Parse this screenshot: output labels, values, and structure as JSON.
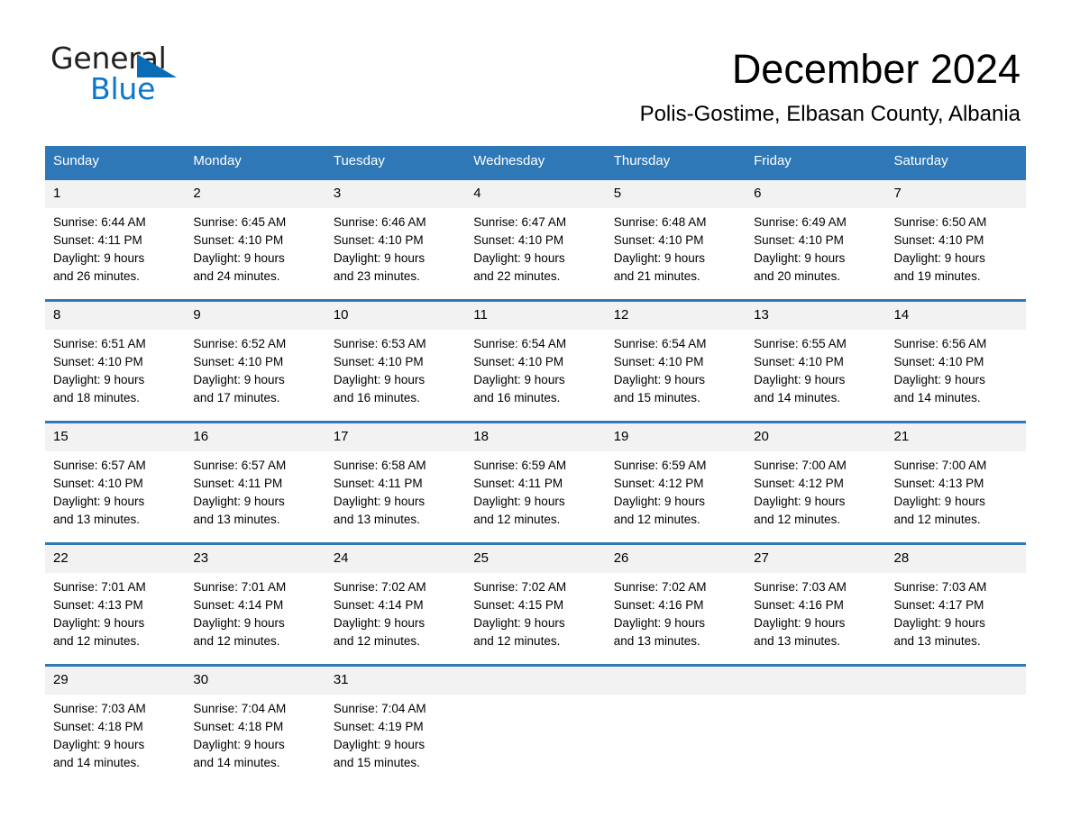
{
  "brand": {
    "name_part1": "General",
    "name_part2": "Blue",
    "triangle_color": "#0a6cb4",
    "blue_text_color": "#0b76cc"
  },
  "header": {
    "month_title": "December 2024",
    "location": "Polis-Gostime, Elbasan County, Albania"
  },
  "theme": {
    "header_blue": "#2e78b8",
    "daynum_band": "#f2f2f2",
    "text": "#000000"
  },
  "weekdays": [
    "Sunday",
    "Monday",
    "Tuesday",
    "Wednesday",
    "Thursday",
    "Friday",
    "Saturday"
  ],
  "weeks": [
    {
      "days": [
        {
          "num": "1",
          "sunrise": "Sunrise: 6:44 AM",
          "sunset": "Sunset: 4:11 PM",
          "daylight_line1": "Daylight: 9 hours",
          "daylight_line2": "and 26 minutes."
        },
        {
          "num": "2",
          "sunrise": "Sunrise: 6:45 AM",
          "sunset": "Sunset: 4:10 PM",
          "daylight_line1": "Daylight: 9 hours",
          "daylight_line2": "and 24 minutes."
        },
        {
          "num": "3",
          "sunrise": "Sunrise: 6:46 AM",
          "sunset": "Sunset: 4:10 PM",
          "daylight_line1": "Daylight: 9 hours",
          "daylight_line2": "and 23 minutes."
        },
        {
          "num": "4",
          "sunrise": "Sunrise: 6:47 AM",
          "sunset": "Sunset: 4:10 PM",
          "daylight_line1": "Daylight: 9 hours",
          "daylight_line2": "and 22 minutes."
        },
        {
          "num": "5",
          "sunrise": "Sunrise: 6:48 AM",
          "sunset": "Sunset: 4:10 PM",
          "daylight_line1": "Daylight: 9 hours",
          "daylight_line2": "and 21 minutes."
        },
        {
          "num": "6",
          "sunrise": "Sunrise: 6:49 AM",
          "sunset": "Sunset: 4:10 PM",
          "daylight_line1": "Daylight: 9 hours",
          "daylight_line2": "and 20 minutes."
        },
        {
          "num": "7",
          "sunrise": "Sunrise: 6:50 AM",
          "sunset": "Sunset: 4:10 PM",
          "daylight_line1": "Daylight: 9 hours",
          "daylight_line2": "and 19 minutes."
        }
      ]
    },
    {
      "days": [
        {
          "num": "8",
          "sunrise": "Sunrise: 6:51 AM",
          "sunset": "Sunset: 4:10 PM",
          "daylight_line1": "Daylight: 9 hours",
          "daylight_line2": "and 18 minutes."
        },
        {
          "num": "9",
          "sunrise": "Sunrise: 6:52 AM",
          "sunset": "Sunset: 4:10 PM",
          "daylight_line1": "Daylight: 9 hours",
          "daylight_line2": "and 17 minutes."
        },
        {
          "num": "10",
          "sunrise": "Sunrise: 6:53 AM",
          "sunset": "Sunset: 4:10 PM",
          "daylight_line1": "Daylight: 9 hours",
          "daylight_line2": "and 16 minutes."
        },
        {
          "num": "11",
          "sunrise": "Sunrise: 6:54 AM",
          "sunset": "Sunset: 4:10 PM",
          "daylight_line1": "Daylight: 9 hours",
          "daylight_line2": "and 16 minutes."
        },
        {
          "num": "12",
          "sunrise": "Sunrise: 6:54 AM",
          "sunset": "Sunset: 4:10 PM",
          "daylight_line1": "Daylight: 9 hours",
          "daylight_line2": "and 15 minutes."
        },
        {
          "num": "13",
          "sunrise": "Sunrise: 6:55 AM",
          "sunset": "Sunset: 4:10 PM",
          "daylight_line1": "Daylight: 9 hours",
          "daylight_line2": "and 14 minutes."
        },
        {
          "num": "14",
          "sunrise": "Sunrise: 6:56 AM",
          "sunset": "Sunset: 4:10 PM",
          "daylight_line1": "Daylight: 9 hours",
          "daylight_line2": "and 14 minutes."
        }
      ]
    },
    {
      "days": [
        {
          "num": "15",
          "sunrise": "Sunrise: 6:57 AM",
          "sunset": "Sunset: 4:10 PM",
          "daylight_line1": "Daylight: 9 hours",
          "daylight_line2": "and 13 minutes."
        },
        {
          "num": "16",
          "sunrise": "Sunrise: 6:57 AM",
          "sunset": "Sunset: 4:11 PM",
          "daylight_line1": "Daylight: 9 hours",
          "daylight_line2": "and 13 minutes."
        },
        {
          "num": "17",
          "sunrise": "Sunrise: 6:58 AM",
          "sunset": "Sunset: 4:11 PM",
          "daylight_line1": "Daylight: 9 hours",
          "daylight_line2": "and 13 minutes."
        },
        {
          "num": "18",
          "sunrise": "Sunrise: 6:59 AM",
          "sunset": "Sunset: 4:11 PM",
          "daylight_line1": "Daylight: 9 hours",
          "daylight_line2": "and 12 minutes."
        },
        {
          "num": "19",
          "sunrise": "Sunrise: 6:59 AM",
          "sunset": "Sunset: 4:12 PM",
          "daylight_line1": "Daylight: 9 hours",
          "daylight_line2": "and 12 minutes."
        },
        {
          "num": "20",
          "sunrise": "Sunrise: 7:00 AM",
          "sunset": "Sunset: 4:12 PM",
          "daylight_line1": "Daylight: 9 hours",
          "daylight_line2": "and 12 minutes."
        },
        {
          "num": "21",
          "sunrise": "Sunrise: 7:00 AM",
          "sunset": "Sunset: 4:13 PM",
          "daylight_line1": "Daylight: 9 hours",
          "daylight_line2": "and 12 minutes."
        }
      ]
    },
    {
      "days": [
        {
          "num": "22",
          "sunrise": "Sunrise: 7:01 AM",
          "sunset": "Sunset: 4:13 PM",
          "daylight_line1": "Daylight: 9 hours",
          "daylight_line2": "and 12 minutes."
        },
        {
          "num": "23",
          "sunrise": "Sunrise: 7:01 AM",
          "sunset": "Sunset: 4:14 PM",
          "daylight_line1": "Daylight: 9 hours",
          "daylight_line2": "and 12 minutes."
        },
        {
          "num": "24",
          "sunrise": "Sunrise: 7:02 AM",
          "sunset": "Sunset: 4:14 PM",
          "daylight_line1": "Daylight: 9 hours",
          "daylight_line2": "and 12 minutes."
        },
        {
          "num": "25",
          "sunrise": "Sunrise: 7:02 AM",
          "sunset": "Sunset: 4:15 PM",
          "daylight_line1": "Daylight: 9 hours",
          "daylight_line2": "and 12 minutes."
        },
        {
          "num": "26",
          "sunrise": "Sunrise: 7:02 AM",
          "sunset": "Sunset: 4:16 PM",
          "daylight_line1": "Daylight: 9 hours",
          "daylight_line2": "and 13 minutes."
        },
        {
          "num": "27",
          "sunrise": "Sunrise: 7:03 AM",
          "sunset": "Sunset: 4:16 PM",
          "daylight_line1": "Daylight: 9 hours",
          "daylight_line2": "and 13 minutes."
        },
        {
          "num": "28",
          "sunrise": "Sunrise: 7:03 AM",
          "sunset": "Sunset: 4:17 PM",
          "daylight_line1": "Daylight: 9 hours",
          "daylight_line2": "and 13 minutes."
        }
      ]
    },
    {
      "days": [
        {
          "num": "29",
          "sunrise": "Sunrise: 7:03 AM",
          "sunset": "Sunset: 4:18 PM",
          "daylight_line1": "Daylight: 9 hours",
          "daylight_line2": "and 14 minutes."
        },
        {
          "num": "30",
          "sunrise": "Sunrise: 7:04 AM",
          "sunset": "Sunset: 4:18 PM",
          "daylight_line1": "Daylight: 9 hours",
          "daylight_line2": "and 14 minutes."
        },
        {
          "num": "31",
          "sunrise": "Sunrise: 7:04 AM",
          "sunset": "Sunset: 4:19 PM",
          "daylight_line1": "Daylight: 9 hours",
          "daylight_line2": "and 15 minutes."
        },
        {
          "num": "",
          "sunrise": "",
          "sunset": "",
          "daylight_line1": "",
          "daylight_line2": ""
        },
        {
          "num": "",
          "sunrise": "",
          "sunset": "",
          "daylight_line1": "",
          "daylight_line2": ""
        },
        {
          "num": "",
          "sunrise": "",
          "sunset": "",
          "daylight_line1": "",
          "daylight_line2": ""
        },
        {
          "num": "",
          "sunrise": "",
          "sunset": "",
          "daylight_line1": "",
          "daylight_line2": ""
        }
      ]
    }
  ]
}
